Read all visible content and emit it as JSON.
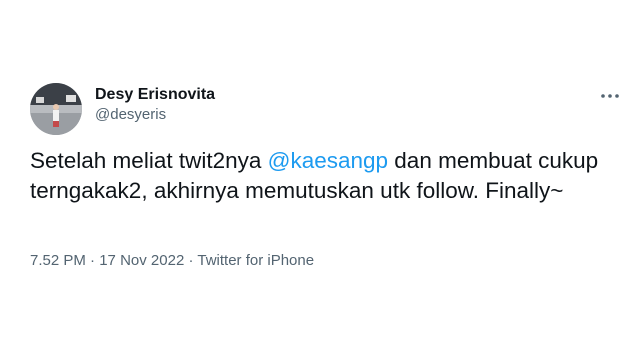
{
  "user": {
    "display_name": "Desy Erisnovita",
    "handle": "@desyeris"
  },
  "more_icon": "more-horizontal-icon",
  "tweet": {
    "text_before": "Setelah meliat twit2nya ",
    "mention": "@kaesangp",
    "text_after": " dan membuat cukup terngakak2, akhirnya memutuskan utk follow. Finally~"
  },
  "meta": {
    "time": "7.52 PM",
    "separator": " · ",
    "date": "17 Nov 2022",
    "source": "Twitter for iPhone"
  },
  "colors": {
    "mention": "#1d9bf0",
    "secondary_text": "#536471",
    "primary_text": "#0f1419"
  }
}
